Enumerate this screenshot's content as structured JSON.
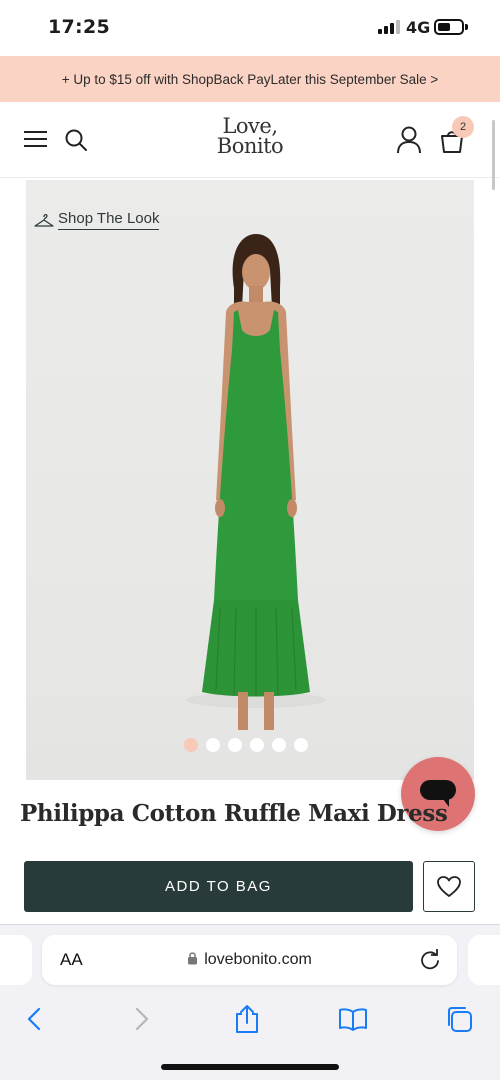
{
  "status_bar": {
    "time": "17:25",
    "network": "4G",
    "battery_level": 0.55
  },
  "promo": {
    "text": "+ Up to $15 off with ShopBack PayLater this September Sale >"
  },
  "header": {
    "logo_line1": "Love,",
    "logo_line2": "Bonito",
    "bag_count": "2"
  },
  "product": {
    "shop_look_label": "Shop The Look",
    "title": "Philippa Cotton Ruffle Maxi Dress",
    "add_to_bag_label": "ADD TO BAG",
    "image_count": 6,
    "active_image_index": 0,
    "dress_color": "#2f9a3c"
  },
  "browser": {
    "text_size_label": "AA",
    "url": "lovebonito.com"
  },
  "colors": {
    "promo_bg": "#fbd3c4",
    "primary_button": "#283b3a",
    "chat_button": "#dd7473",
    "badge": "#f7c9b6"
  }
}
